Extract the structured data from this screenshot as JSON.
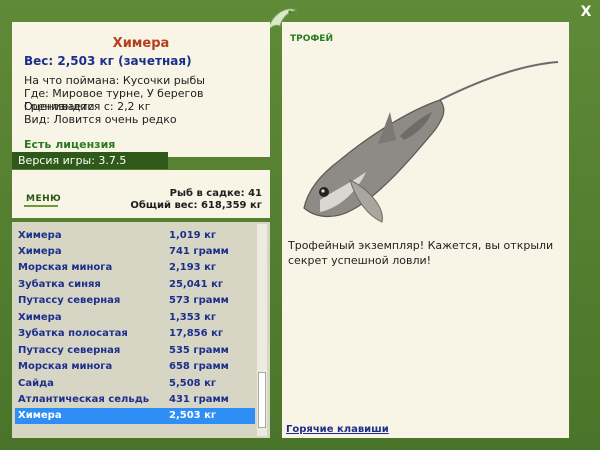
{
  "info": {
    "fish_name": "Химера",
    "weight_line": "Вес: 2,503 кг (зачетная)",
    "details": [
      "На что поймана: Кусочки рыбы",
      "Где: Мировое турне, У берегов Гренландии",
      "Оценивается с: 2,2 кг",
      "Вид: Ловится очень редко"
    ]
  },
  "license_label": "Есть лицензия",
  "version_label": "Версия игры: 3.7.5",
  "menu_label": "МЕНЮ",
  "stats": {
    "fish_count": "Рыб в садке: 41",
    "total_weight": "Общий вес: 618,359 кг"
  },
  "catch_list": [
    {
      "name": "Химера",
      "weight": "1,019 кг"
    },
    {
      "name": "Химера",
      "weight": "741 грамм"
    },
    {
      "name": "Морская минога",
      "weight": "2,193 кг"
    },
    {
      "name": "Зубатка синяя",
      "weight": "25,041 кг"
    },
    {
      "name": "Путассу северная",
      "weight": "573 грамм"
    },
    {
      "name": "Химера",
      "weight": "1,353 кг"
    },
    {
      "name": "Зубатка полосатая",
      "weight": "17,856 кг"
    },
    {
      "name": "Путассу северная",
      "weight": "535 грамм"
    },
    {
      "name": "Морская минога",
      "weight": "658 грамм"
    },
    {
      "name": "Сайда",
      "weight": "5,508 кг"
    },
    {
      "name": "Атлантическая сельдь",
      "weight": "431 грамм"
    },
    {
      "name": "Химера",
      "weight": "2,503 кг",
      "selected": true
    }
  ],
  "trophy": {
    "title": "ТРОФЕЙ",
    "message": "Трофейный экземпляр! Кажется, вы открыли секрет успешной ловли!",
    "hotkeys_link": "Горячие клавиши"
  },
  "close_label": "X",
  "colors": {
    "frame_green": "#4e7a2e",
    "panel_cream": "#f8f5e6",
    "title_red": "#b5401c",
    "link_blue": "#1d2f8c",
    "selection_blue": "#2f8ef5"
  },
  "icons": [
    "fish-logo-icon",
    "fish-trophy-image"
  ]
}
